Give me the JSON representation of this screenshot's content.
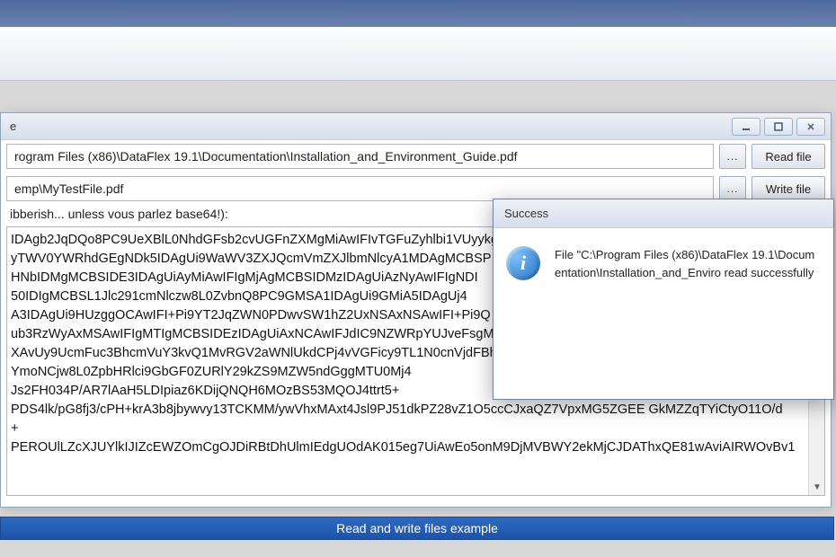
{
  "mainWindow": {
    "titleFragment": "e",
    "readPath": "rogram Files (x86)\\DataFlex 19.1\\Documentation\\Installation_and_Environment_Guide.pdf",
    "writePath": "emp\\MyTestFile.pdf",
    "browseLabel": "...",
    "readBtn": "Read file",
    "writeBtn": "Write file",
    "gibberishLabel": "ibberish... unless vous parlez base64!):",
    "content": "IDAgb2JqDQo8PC9UeXBlL0NhdGFsb2cvUGFnZXMgMiAwIFIvTGFuZyhlbi1VUyykg\nyTWV0YWRhdGEgNDk5IDAgUi9WaWV3ZXJQcmVmZXJlbmNlcyA1MDAgMCBSP\nHNbIDMgMCBSIDE3IDAgUiAyMiAwIFIgMjAgMCBSIDMzIDAgUiAzNyAwIFIgNDI\n50IDIgMCBSL1Jlc291cmNlczw8L0ZvbnQ8PC9GMSA1IDAgUi9GMiA5IDAgUj4\nA3IDAgUi9HUzggOCAwIFI+Pi9YT2JqZWN0PDwvSW1hZ2UxNSAxNSAwIFI+Pi9Q\nub3RzWyAxMSAwIFIgMTIgMCBSIDEzIDAgUiAxNCAwIFJdIC9NZWRpYUJveFsgM\nXAvUy9UcmFuc3BhcmVuY3kvQ1MvRGV2aWNlUkdCPj4vVGFicy9TL1N0cnVjdFBh\nYmoNCjw8L0ZpbHRlci9GbGF0ZURlY29kZS9MZW5ndGggMTU0Mj4\nJs2FH034P/AR7lAaH5LDIpiaz6KDijQNQH6MOzBS53MQOJ4ttrt5+\nPDS4lk/pG8fj3/cPH+krA3b8jbywvy13TCKMM/ywVhxMAxt4Jsl9PJ51dkPZ28vZ1O5ccCJxaQZ7VpxMG5ZGEE GkMZZqTYiCtyO11O/d\n+\nPEROUlLZcXJUYlkIJIZcEWZOmCgOJDiRBtDhUlmIEdgUOdAK015eg7UiAwEo5onM9DjMVBWY2ekMjCJDAThxQE81wAviAIRWOvBv1"
  },
  "statusBar": {
    "text": "Read and write files example"
  },
  "dialog": {
    "title": "Success",
    "iconGlyph": "i",
    "message": "File \"C:\\Program Files (x86)\\DataFlex 19.1\\Documentation\\Installation_and_Enviro read successfully"
  }
}
